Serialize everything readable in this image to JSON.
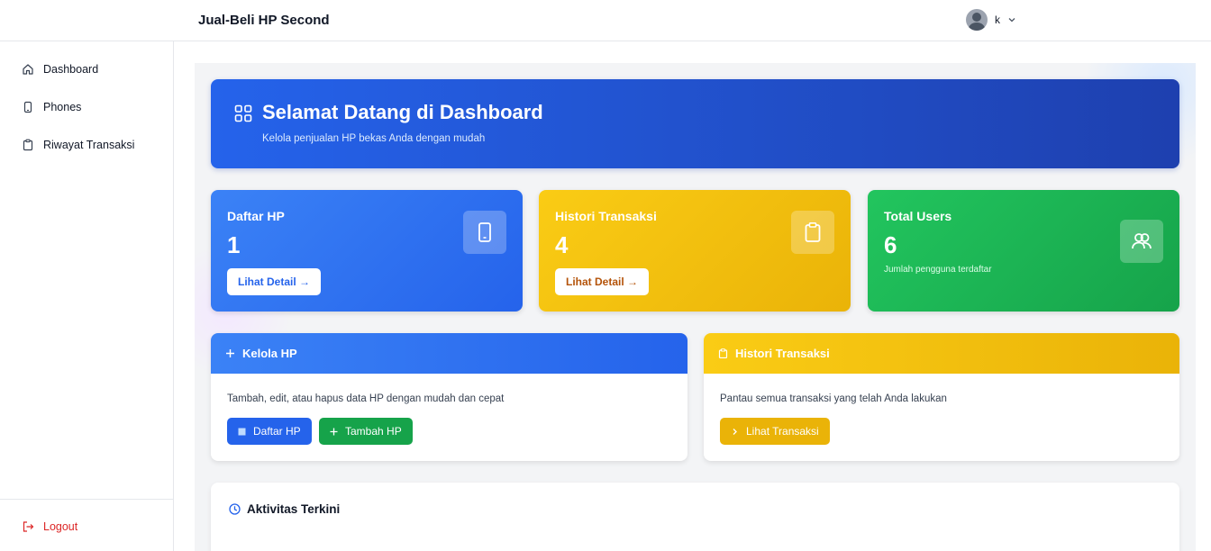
{
  "app": {
    "title": "Jual-Beli HP Second"
  },
  "user": {
    "name": "k",
    "avatar_icon": "user-avatar-icon",
    "menu_icon": "chevron-down-icon"
  },
  "sidebar": {
    "items": [
      {
        "label": "Dashboard",
        "icon": "home-icon"
      },
      {
        "label": "Phones",
        "icon": "phone-icon"
      },
      {
        "label": "Riwayat Transaksi",
        "icon": "clipboard-icon"
      }
    ],
    "logout": {
      "label": "Logout",
      "icon": "logout-icon",
      "color": "#dc2626"
    }
  },
  "hero": {
    "title": "Selamat Datang di Dashboard",
    "subtitle": "Kelola penjualan HP bekas Anda dengan mudah",
    "icon": "grid-icon"
  },
  "stats": [
    {
      "title": "Daftar HP",
      "value": "1",
      "button": "Lihat Detail →",
      "icon": "phone-icon",
      "color": "#2563eb"
    },
    {
      "title": "Histori Transaksi",
      "value": "4",
      "button": "Lihat Detail →",
      "icon": "clipboard-icon",
      "color": "#eab308"
    },
    {
      "title": "Total Users",
      "value": "6",
      "note": "Jumlah pengguna terdaftar",
      "icon": "users-icon",
      "color": "#16a34a"
    }
  ],
  "panels": {
    "kelola": {
      "title": "Kelola HP",
      "text": "Tambah, edit, atau hapus data HP dengan mudah dan cepat",
      "buttons": [
        "Daftar HP",
        "Tambah HP"
      ]
    },
    "histori": {
      "title": "Histori Transaksi",
      "text": "Pantau semua transaksi yang telah Anda lakukan",
      "button": "Lihat Transaksi"
    }
  },
  "activity": {
    "title": "Aktivitas Terkini",
    "icon": "clock-icon"
  }
}
